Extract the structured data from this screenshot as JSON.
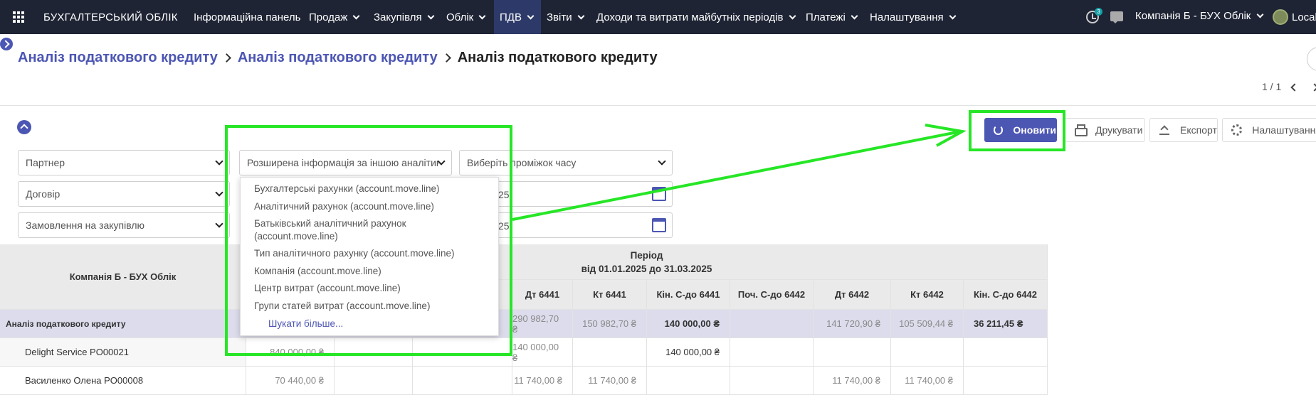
{
  "topbar": {
    "brand": "БУХГАЛТЕРСЬКИЙ ОБЛІК",
    "menu": [
      {
        "label": "Інформаційна панель"
      },
      {
        "label": "Продаж"
      },
      {
        "label": "Закупівля"
      },
      {
        "label": "Облік"
      },
      {
        "label": "ПДВ"
      },
      {
        "label": "Звіти"
      },
      {
        "label": "Доходи та витрати майбутніх періодів"
      },
      {
        "label": "Платежі"
      },
      {
        "label": "Налаштування"
      }
    ],
    "activity_badge": "3",
    "company": "Компанія Б - БУХ Облік",
    "user": "Local"
  },
  "breadcrumb": {
    "items": [
      "Аналіз податкового кредиту",
      "Аналіз податкового кредиту"
    ],
    "current": "Аналіз податкового кредиту"
  },
  "pager": {
    "value": "1 / 1"
  },
  "toolbar": {
    "refresh": "Оновити",
    "print": "Друкувати",
    "export": "Експорт",
    "settings": "Налаштування"
  },
  "filters": {
    "partner": "Партнер",
    "extended": "Розширена інформація за іншою аналітико",
    "period": "Виберіть проміжок часу",
    "contract": "Договір",
    "purchase_order": "Замовлення на закупівлю",
    "date_from_fragment": "25",
    "date_to_fragment": "25"
  },
  "dropdown": {
    "items": [
      "Бухгалтерські рахунки (account.move.line)",
      "Аналітичний рахунок (account.move.line)",
      "Батьківський аналітичний рахунок (account.move.line)",
      "Тип аналітичного рахунку (account.move.line)",
      "Компанія (account.move.line)",
      "Центр витрат (account.move.line)",
      "Групи статей витрат (account.move.line)"
    ],
    "more": "Шукати більше..."
  },
  "table": {
    "company_header": "Компанія Б - БУХ Облік",
    "period_header": "Період",
    "period_range": "від 01.01.2025 до 31.03.2025",
    "columns": [
      "Дт 6441",
      "Кт 6441",
      "Кін. С-до 6441",
      "Поч. С-до 6442",
      "Дт 6442",
      "Кт 6442",
      "Кін. С-до 6442"
    ],
    "group_row": {
      "label": "Аналіз податкового кредиту",
      "values": [
        "290 982,70 ₴",
        "150 982,70 ₴",
        "140 000,00 ₴",
        "",
        "141 720,90 ₴",
        "105 509,44 ₴",
        "36 211,45 ₴"
      ]
    },
    "rows": [
      {
        "label": "Delight Service PO00021",
        "first": "840 000,00 ₴",
        "values": [
          "140 000,00 ₴",
          "",
          "140 000,00 ₴",
          "",
          "",
          "",
          ""
        ]
      },
      {
        "label": "Василенко Олена PO00008",
        "first": "70 440,00 ₴",
        "values": [
          "11 740,00 ₴",
          "11 740,00 ₴",
          "",
          "",
          "11 740,00 ₴",
          "11 740,00 ₴",
          ""
        ]
      }
    ]
  },
  "colors": {
    "topbar": "#1e2434",
    "accent": "#4c56b3",
    "annotation": "#26e626",
    "group_row": "#dcdcec"
  }
}
